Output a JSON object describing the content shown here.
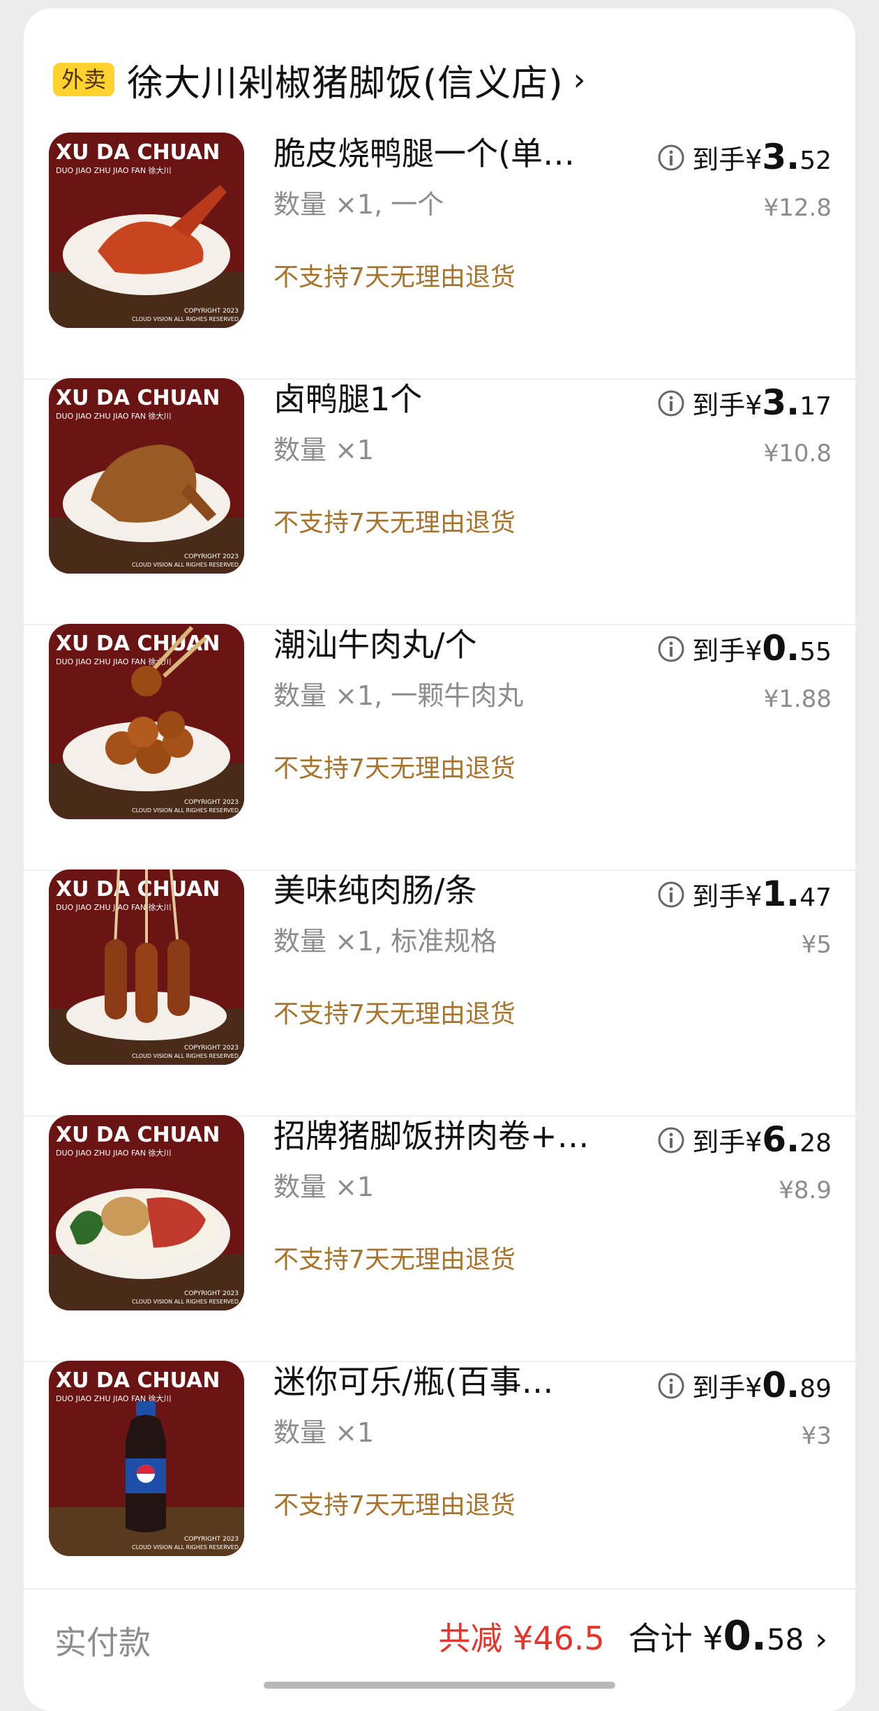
{
  "shop": {
    "tag": "外卖",
    "name": "徐大川剁椒猪脚饭(信义店)",
    "arrow": "›"
  },
  "thumbnail_brand": {
    "title": "XU DA CHUAN",
    "subtitle": "DUO JIAO ZHU JIAO FAN 徐大川",
    "copyright_line1": "COPYRIGHT 2023",
    "copyright_line2": "CLOUD VISION ALL RIGHES RESERVED"
  },
  "items": [
    {
      "title": "脆皮烧鸭腿一个(单…",
      "qty": "数量 ×1, 一个",
      "policy": "不支持7天无理由退货",
      "price_label": "到手¥",
      "price_int": "3.",
      "price_dec": "52",
      "orig_price": "¥12.8",
      "thumb_food": "roast-duck-leg"
    },
    {
      "title": "卤鸭腿1个",
      "qty": "数量 ×1",
      "policy": "不支持7天无理由退货",
      "price_label": "到手¥",
      "price_int": "3.",
      "price_dec": "17",
      "orig_price": "¥10.8",
      "thumb_food": "braised-duck-leg"
    },
    {
      "title": "潮汕牛肉丸/个",
      "qty": "数量 ×1, 一颗牛肉丸",
      "policy": "不支持7天无理由退货",
      "price_label": "到手¥",
      "price_int": "0.",
      "price_dec": "55",
      "orig_price": "¥1.88",
      "thumb_food": "beef-balls"
    },
    {
      "title": "美味纯肉肠/条",
      "qty": "数量 ×1, 标准规格",
      "policy": "不支持7天无理由退货",
      "price_label": "到手¥",
      "price_int": "1.",
      "price_dec": "47",
      "orig_price": "¥5",
      "thumb_food": "sausages"
    },
    {
      "title": "招牌猪脚饭拼肉卷+…",
      "qty": "数量 ×1",
      "policy": "不支持7天无理由退货",
      "price_label": "到手¥",
      "price_int": "6.",
      "price_dec": "28",
      "orig_price": "¥8.9",
      "thumb_food": "pork-trotter-rice"
    },
    {
      "title": "迷你可乐/瓶(百事…",
      "qty": "数量 ×1",
      "policy": "不支持7天无理由退货",
      "price_label": "到手¥",
      "price_int": "0.",
      "price_dec": "89",
      "orig_price": "¥3",
      "thumb_food": "pepsi-bottle"
    }
  ],
  "footer": {
    "label": "实付款",
    "discount": "共减 ¥46.5",
    "total_label": "合计 ¥",
    "total_int": "0.",
    "total_dec": "58",
    "arrow": "›"
  },
  "colors": {
    "tag_bg": "#ffd230",
    "policy": "#a8742a",
    "discount": "#e8332b",
    "thumb_bg": "#6b1414"
  }
}
